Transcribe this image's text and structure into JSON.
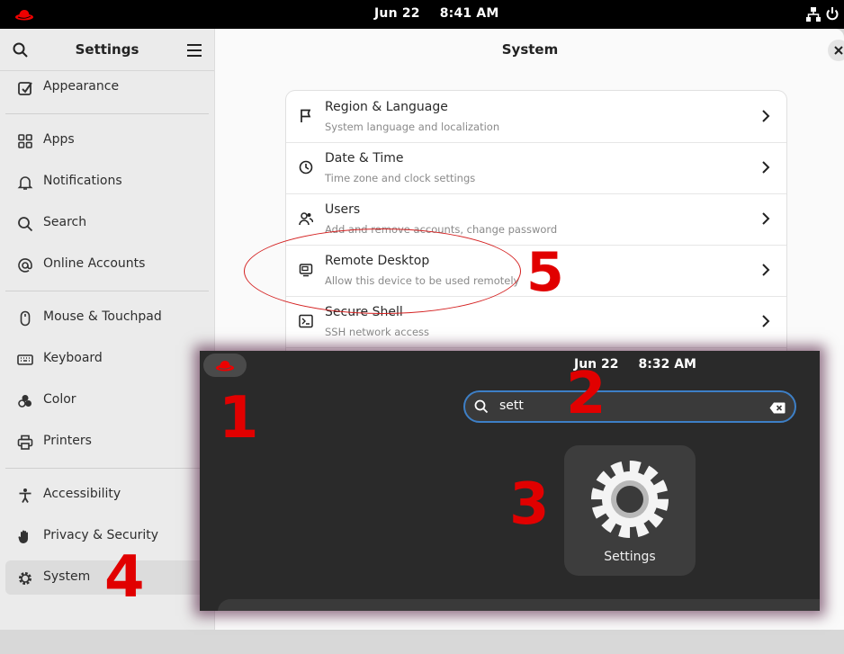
{
  "topbar": {
    "date": "Jun 22",
    "time": "8:41 AM"
  },
  "sidebar": {
    "title": "Settings",
    "items": [
      {
        "label": "Appearance"
      },
      {
        "label": "Apps"
      },
      {
        "label": "Notifications"
      },
      {
        "label": "Search"
      },
      {
        "label": "Online Accounts"
      },
      {
        "label": "Mouse & Touchpad"
      },
      {
        "label": "Keyboard"
      },
      {
        "label": "Color"
      },
      {
        "label": "Printers"
      },
      {
        "label": "Accessibility"
      },
      {
        "label": "Privacy & Security"
      },
      {
        "label": "System"
      }
    ]
  },
  "content": {
    "title": "System",
    "rows": [
      {
        "title": "Region & Language",
        "subtitle": "System language and localization"
      },
      {
        "title": "Date & Time",
        "subtitle": "Time zone and clock settings"
      },
      {
        "title": "Users",
        "subtitle": "Add and remove accounts, change password"
      },
      {
        "title": "Remote Desktop",
        "subtitle": "Allow this device to be used remotely"
      },
      {
        "title": "Secure Shell",
        "subtitle": "SSH network access"
      }
    ]
  },
  "overlay": {
    "date": "Jun 22",
    "time": "8:32 AM",
    "search_value": "sett",
    "app_label": "Settings"
  },
  "annotations": {
    "n1": "1",
    "n2": "2",
    "n3": "3",
    "n4": "4",
    "n5": "5"
  },
  "colors": {
    "annotation": "#e10000",
    "accent": "#3d7fc6",
    "brand": "#ee0000"
  }
}
